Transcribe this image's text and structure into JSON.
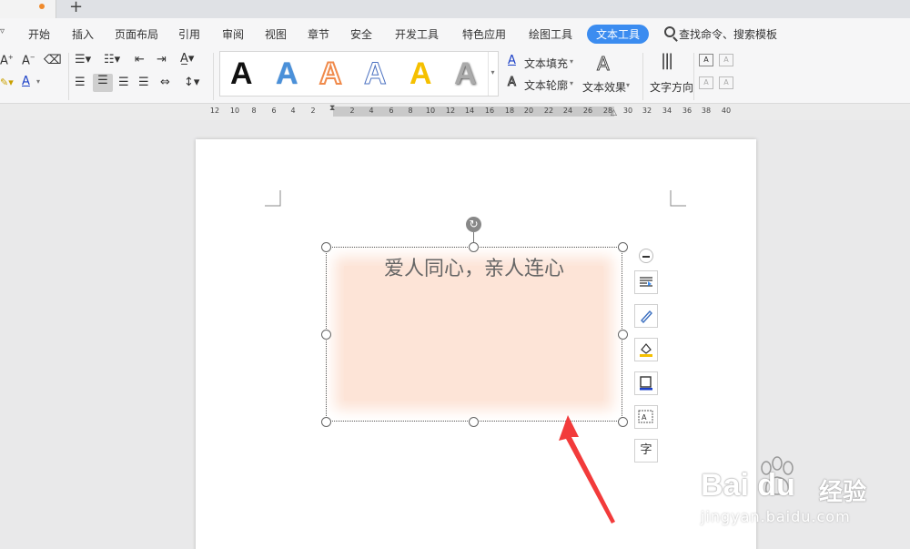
{
  "tabstrip": {
    "new_tab": "+"
  },
  "menu": {
    "items": [
      "开始",
      "插入",
      "页面布局",
      "引用",
      "审阅",
      "视图",
      "章节",
      "安全",
      "开发工具",
      "特色应用",
      "绘图工具"
    ],
    "active": "文本工具",
    "search": "查找命令、搜索模板"
  },
  "ribbon": {
    "text_fill": "文本填充",
    "text_outline": "文本轮廓",
    "text_effect": "文本效果",
    "text_direction": "文字方向",
    "gallery": [
      {
        "glyph": "A",
        "color": "#111111"
      },
      {
        "glyph": "A",
        "color": "#4a90d9"
      },
      {
        "glyph": "A",
        "color": "#f08a4b"
      },
      {
        "glyph": "A",
        "color": "#ffffff"
      },
      {
        "glyph": "A",
        "color": "#f5c000"
      },
      {
        "glyph": "A",
        "color": "#999999"
      }
    ]
  },
  "ruler": {
    "labels": [
      "12",
      "10",
      "8",
      "6",
      "4",
      "2",
      "2",
      "4",
      "6",
      "8",
      "10",
      "12",
      "14",
      "16",
      "18",
      "20",
      "22",
      "24",
      "26",
      "28",
      "30",
      "32",
      "34",
      "36",
      "38",
      "40"
    ]
  },
  "textbox": {
    "text": "爱人同心，亲人连心",
    "glow_color": "#fde4d7"
  },
  "side_toolbar": {
    "layout_icon": "layout-icon",
    "pen_icon": "pen-icon",
    "fill_icon": "fill-icon",
    "border_icon": "border-icon",
    "textbox_icon": "textbox-icon",
    "font_label": "字"
  },
  "watermark": {
    "logo": "Bai du",
    "brand": "经验",
    "url": "jingyan.baidu.com"
  }
}
